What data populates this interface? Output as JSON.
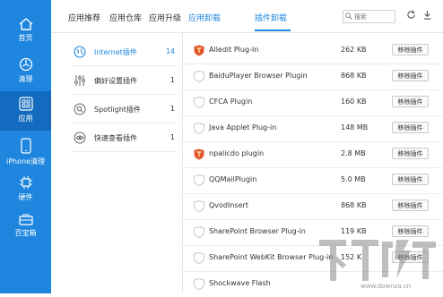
{
  "sidebar": {
    "items": [
      {
        "label": "首页",
        "icon": "home-icon"
      },
      {
        "label": "清理",
        "icon": "clean-icon"
      },
      {
        "label": "应用",
        "icon": "apps-icon"
      },
      {
        "label": "iPhone清理",
        "icon": "iphone-icon"
      },
      {
        "label": "硬件",
        "icon": "hardware-icon"
      },
      {
        "label": "百宝箱",
        "icon": "toolbox-icon"
      }
    ],
    "active": "应用"
  },
  "topbar": {
    "tabs": [
      {
        "label": "应用推荐"
      },
      {
        "label": "应用仓库"
      },
      {
        "label": "应用升级"
      },
      {
        "label": "应用卸载"
      },
      {
        "label": "插件卸载"
      }
    ],
    "active_tab": "插件卸载",
    "search_placeholder": "搜索"
  },
  "categories": [
    {
      "label": "Internet插件",
      "count": "14",
      "icon": "globe-icon"
    },
    {
      "label": "偏好设置插件",
      "count": "1",
      "icon": "sliders-icon"
    },
    {
      "label": "Spotlight插件",
      "count": "1",
      "icon": "search-icon"
    },
    {
      "label": "快速查看插件",
      "count": "1",
      "icon": "eye-icon"
    }
  ],
  "plugins": [
    {
      "name": "Alledit Plug-In",
      "size": "262 KB",
      "button": "移除插件",
      "icon": "orange-shield-icon"
    },
    {
      "name": "BaiduPlayer Browser Plugin",
      "size": "868 KB",
      "button": "移除插件",
      "icon": "gray-shield-icon"
    },
    {
      "name": "CFCA Plugin",
      "size": "160 KB",
      "button": "移除插件",
      "icon": "gray-shield-icon"
    },
    {
      "name": "Java Applet Plug-in",
      "size": "148 MB",
      "button": "移除插件",
      "icon": "gray-shield-icon"
    },
    {
      "name": "npalicdo plugin",
      "size": "2.8 MB",
      "button": "移除插件",
      "icon": "orange-shield-icon"
    },
    {
      "name": "QQMailPlugin",
      "size": "5.0 MB",
      "button": "移除插件",
      "icon": "gray-shield-icon"
    },
    {
      "name": "QvodInsert",
      "size": "868 KB",
      "button": "移除插件",
      "icon": "gray-shield-icon"
    },
    {
      "name": "SharePoint Browser Plug-in",
      "size": "119 KB",
      "button": "移除插件",
      "icon": "gray-shield-icon"
    },
    {
      "name": "SharePoint WebKit Browser Plug-in",
      "size": "152 K",
      "button": "移除插件",
      "icon": "gray-shield-icon"
    },
    {
      "name": "Shockwave Flash",
      "size": "",
      "button": "",
      "icon": "gray-shield-icon"
    }
  ],
  "watermark": {
    "site": "www.downza.cn"
  },
  "colors": {
    "accent": "#1e86de",
    "sidebar": "#1e86de",
    "sidebar_active": "#136bc0",
    "orange_shield": "#e0572b",
    "gray_shield": "#c8c8c8"
  }
}
